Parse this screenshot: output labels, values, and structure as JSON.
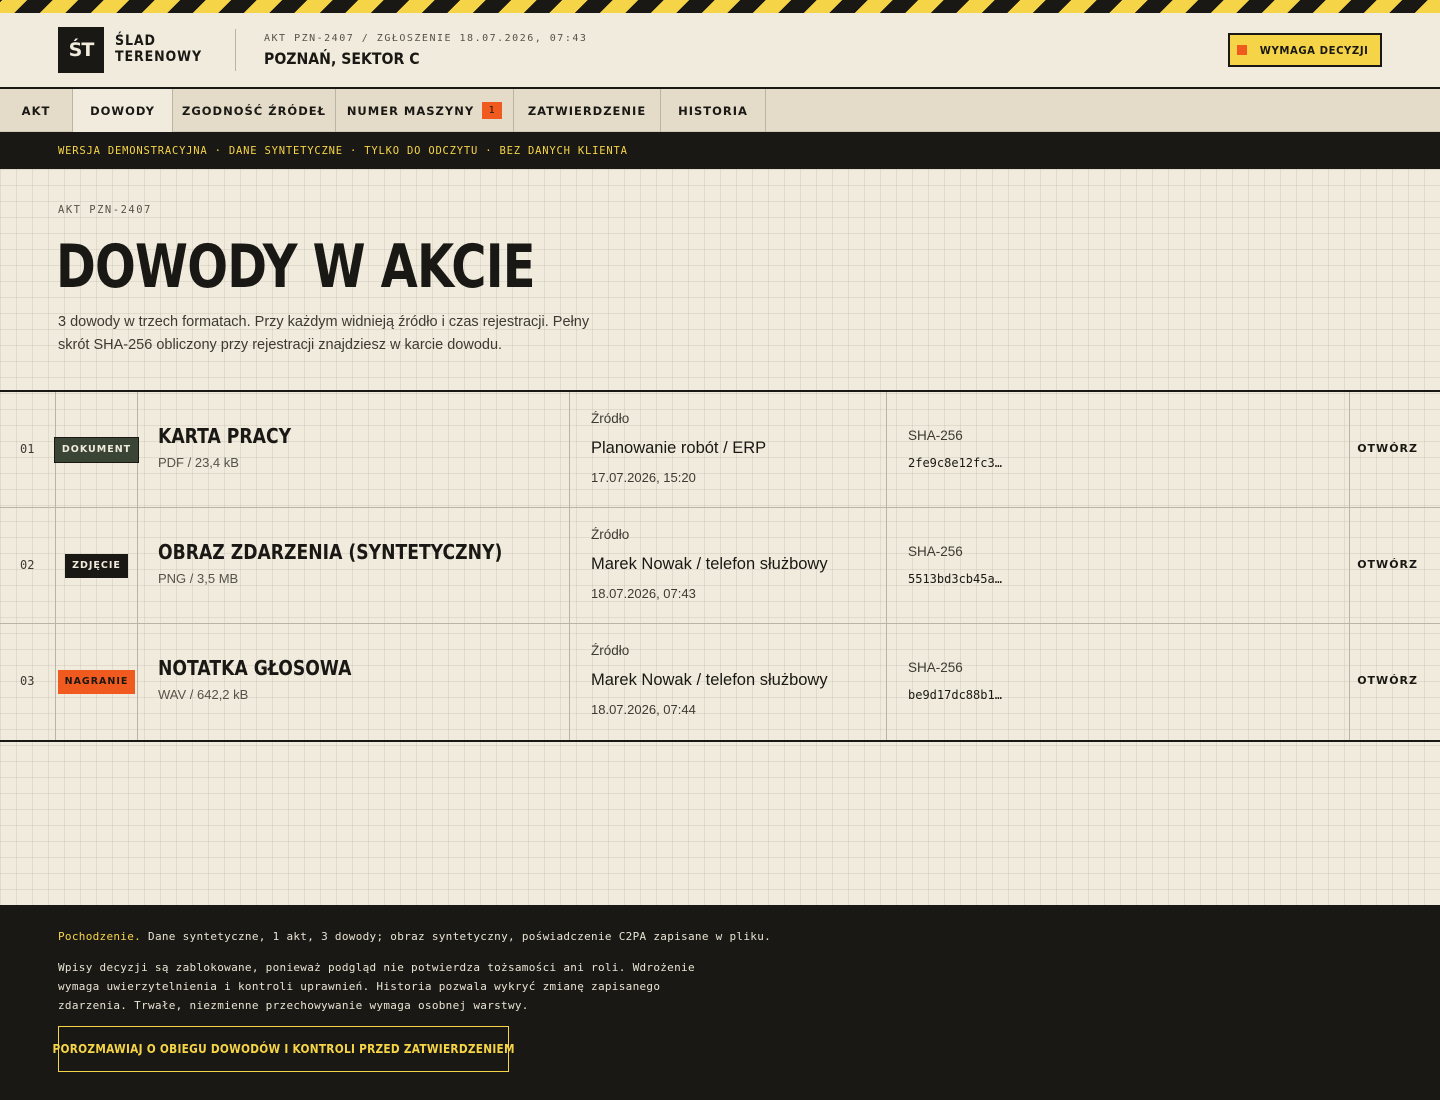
{
  "header": {
    "logo_mark": "ŚT",
    "logo_line1": "ŚLAD",
    "logo_line2": "TERENOWY",
    "case_meta": "AKT PZN-2407 / ZGŁOSZENIE 18.07.2026, 07:43",
    "case_title": "POZNAŃ, SEKTOR C",
    "decision_label": "WYMAGA DECYZJI"
  },
  "tabs": [
    {
      "label": "AKT",
      "active": false
    },
    {
      "label": "DOWODY",
      "active": true
    },
    {
      "label": "ZGODNOŚĆ ŹRÓDEŁ",
      "active": false
    },
    {
      "label": "NUMER MASZYNY",
      "active": false,
      "count": "1"
    },
    {
      "label": "ZATWIERDZENIE",
      "active": false
    },
    {
      "label": "HISTORIA",
      "active": false
    }
  ],
  "banner": "WERSJA DEMONSTRACYJNA · DANE SYNTETYCZNE · TYLKO DO ODCZYTU · BEZ DANYCH KLIENTA",
  "main": {
    "eyebrow": "AKT PZN-2407",
    "title": "DOWODY W AKCIE",
    "lead": "3 dowody w trzech formatach. Przy każdym widnieją źródło i czas rejestracji. Pełny skrót SHA-256 obliczony przy rejestracji znajdziesz w karcie dowodu."
  },
  "evidence": [
    {
      "num": "01",
      "type": "DOKUMENT",
      "name": "KARTA PRACY",
      "format": "PDF / 23,4 kB",
      "source_label": "Źródło",
      "source": "Planowanie robót / ERP",
      "date": "17.07.2026, 15:20",
      "hash_label": "SHA-256",
      "hash": "2fe9c8e12fc3…",
      "open": "OTWÓRZ"
    },
    {
      "num": "02",
      "type": "ZDJĘCIE",
      "name": "OBRAZ ZDARZENIA (SYNTETYCZNY)",
      "format": "PNG / 3,5 MB",
      "source_label": "Źródło",
      "source": "Marek Nowak / telefon służbowy",
      "date": "18.07.2026, 07:43",
      "hash_label": "SHA-256",
      "hash": "5513bd3cb45a…",
      "open": "OTWÓRZ"
    },
    {
      "num": "03",
      "type": "NAGRANIE",
      "name": "NOTATKA GŁOSOWA",
      "format": "WAV / 642,2 kB",
      "source_label": "Źródło",
      "source": "Marek Nowak / telefon służbowy",
      "date": "18.07.2026, 07:44",
      "hash_label": "SHA-256",
      "hash": "be9d17dc88b1…",
      "open": "OTWÓRZ"
    }
  ],
  "footer": {
    "provenance_label": "Pochodzenie.",
    "provenance_text": "Dane syntetyczne, 1 akt, 3 dowody; obraz syntetyczny, poświadczenie C2PA zapisane w pliku.",
    "note": "Wpisy decyzji są zablokowane, ponieważ podgląd nie potwierdza tożsamości ani roli. Wdrożenie wymaga uwierzytelnienia i kontroli uprawnień. Historia pozwala wykryć zmianę zapisanego zdarzenia. Trwałe, niezmienne przechowywanie wymaga osobnej warstwy.",
    "cta": "POROZMAWIAJ O OBIEGU DOWODÓW I KONTROLI PRZED ZATWIERDZENIEM"
  },
  "colors": {
    "accent_yellow": "#f5d547",
    "accent_orange": "#f05a1e",
    "ink": "#1a1814",
    "paper": "#f0ebdc",
    "tag_document": "#3a4536",
    "tag_photo": "#1a1814",
    "tag_recording": "#f05a1e"
  }
}
